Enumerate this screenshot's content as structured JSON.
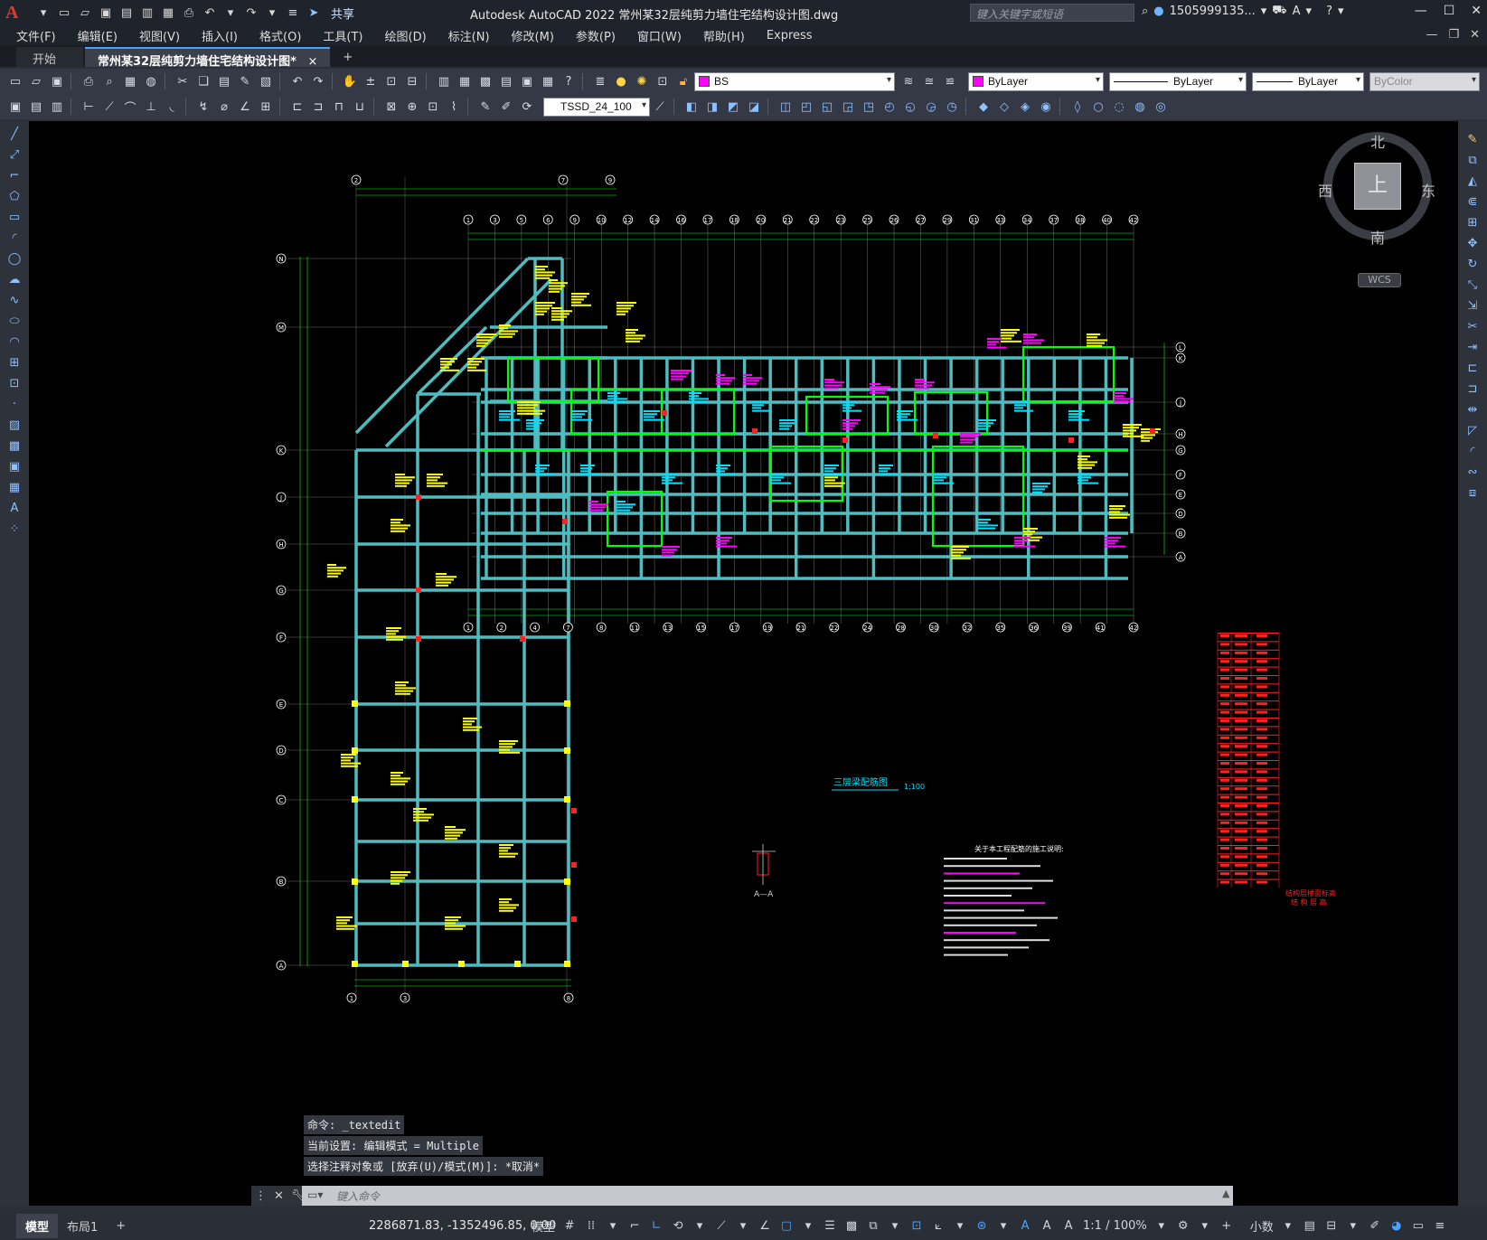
{
  "titlebar": {
    "logo": "A",
    "share": "共享",
    "app_title": "Autodesk AutoCAD 2022    常州某32层纯剪力墙住宅结构设计图.dwg",
    "search_placeholder": "键入关键字或短语",
    "user": "1505999135...",
    "cart_icon": "cart-icon",
    "help": "?"
  },
  "menu": [
    "文件(F)",
    "编辑(E)",
    "视图(V)",
    "插入(I)",
    "格式(O)",
    "工具(T)",
    "绘图(D)",
    "标注(N)",
    "修改(M)",
    "参数(P)",
    "窗口(W)",
    "帮助(H)",
    "Express"
  ],
  "tabs": {
    "start": "开始",
    "drawing": "常州某32层纯剪力墙住宅结构设计图*",
    "close": "×",
    "add": "+"
  },
  "toolbar1": {
    "layer": "BS",
    "color": "ByLayer",
    "linetype": "ByLayer",
    "lineweight": "ByLayer",
    "plotstyle": "ByColor",
    "layer_color": "#ff00ff"
  },
  "toolbar2": {
    "dimstyle": "TSSD_24_100"
  },
  "viewcube": {
    "north": "北",
    "south": "南",
    "east": "东",
    "west": "西",
    "face": "上",
    "wcs": "WCS"
  },
  "drawing": {
    "plan_title": "三层梁配筋图",
    "scale": "1:100",
    "section": "A—A",
    "notes_title": "关于本工程配筋的施工说明:",
    "table_title_1": "结构层楼面标高",
    "table_title_2": "结 构 层 高",
    "row_axes": [
      "N",
      "M",
      "K",
      "J",
      "H",
      "G",
      "F",
      "E",
      "D",
      "C",
      "B",
      "A"
    ],
    "right_axes": [
      "L",
      "K",
      "J",
      "H",
      "G",
      "F",
      "E",
      "D",
      "B",
      "A"
    ],
    "top_axes": [
      "1",
      "3",
      "5",
      "6",
      "9",
      "10",
      "12",
      "14",
      "16",
      "17",
      "18",
      "20",
      "21",
      "22",
      "23",
      "25",
      "26",
      "27",
      "29",
      "31",
      "33",
      "34",
      "37",
      "38",
      "40",
      "42"
    ],
    "bottom_axes": [
      "1",
      "2",
      "4",
      "7",
      "8",
      "11",
      "13",
      "15",
      "17",
      "19",
      "21",
      "22",
      "24",
      "28",
      "30",
      "32",
      "35",
      "36",
      "39",
      "41",
      "42"
    ],
    "top_left_axes": [
      "2",
      "7",
      "9"
    ],
    "bottom_left_axes": [
      "1",
      "3",
      "8"
    ]
  },
  "command": {
    "history": [
      "命令: _textedit",
      "当前设置: 编辑模式 = Multiple",
      "选择注释对象或 [放弃(U)/模式(M)]: *取消*"
    ],
    "placeholder": "键入命令"
  },
  "status": {
    "model_tab": "模型",
    "layout_tab": "布局1",
    "add": "+",
    "coords": "2286871.83, -1352496.85, 0.00",
    "model": "模型",
    "scale": "1:1 / 100%",
    "units": "小数"
  },
  "colors": {
    "wall": "#4fbcc0",
    "green": "#00ff00",
    "yellow": "#ffff00",
    "magenta": "#ff00ff",
    "red": "#ff2020",
    "cyan": "#00e0ff",
    "grid": "#cfcfcf"
  }
}
